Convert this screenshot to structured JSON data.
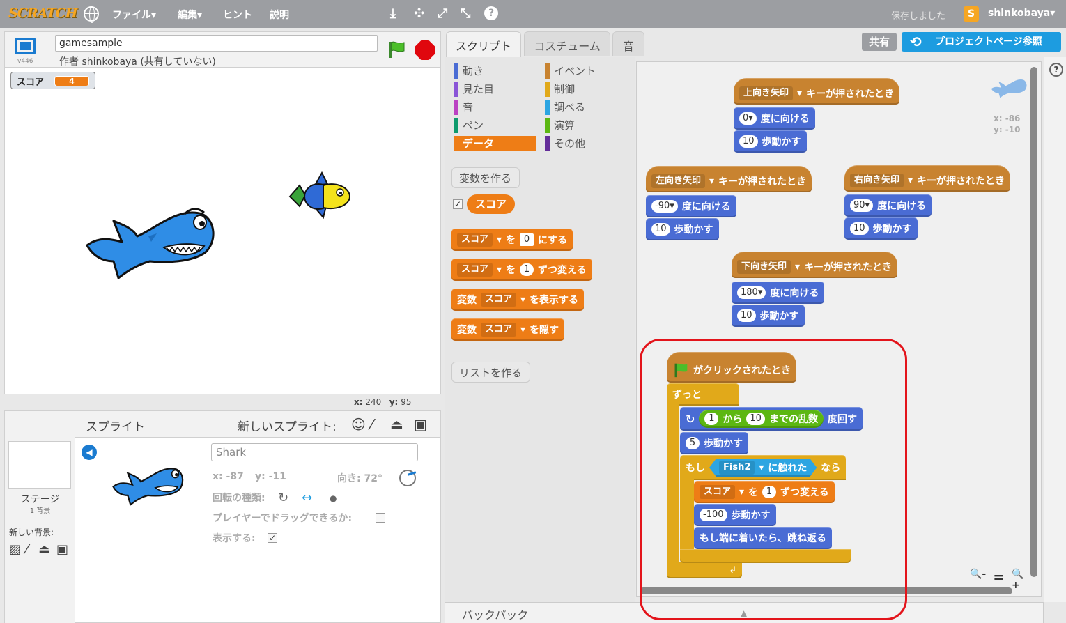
{
  "topbar": {
    "logo": "SCRATCH",
    "menu": [
      "ファイル▾",
      "編集▾",
      "ヒント",
      "説明"
    ],
    "tools": [
      "⤓",
      "✣",
      "⤢",
      "⤡",
      "?"
    ],
    "saved_status": "保存しました",
    "user_initial": "S",
    "user_name": "shinkobaya▾"
  },
  "stage": {
    "version": "v446",
    "project_title": "gamesample",
    "author": "作者 shinkobaya (共有していない)",
    "monitor": {
      "label": "スコア",
      "value": "4"
    },
    "coords": {
      "x_label": "x:",
      "x_value": "240",
      "y_label": "y:",
      "y_value": "95"
    }
  },
  "sprite_pane": {
    "title": "スプライト",
    "new_sprite_label": "新しいスプライト:",
    "stage_label": "ステージ",
    "stage_bg_count": "1 背景",
    "new_bg_label": "新しい背景:",
    "sprite_name": "Shark",
    "x_label": "x: -87",
    "y_label": "y: -11",
    "direction_label": "向き: 72°",
    "rotation_label": "回転の種類:",
    "drag_label": "プレイヤーでドラッグできるか:",
    "show_label": "表示する:",
    "show_checked": "✓"
  },
  "tabs": {
    "scripts": "スクリプト",
    "costumes": "コスチューム",
    "sounds": "音"
  },
  "header_buttons": {
    "share": "共有",
    "project_page": "プロジェクトページ参照"
  },
  "palette": {
    "categories_left": [
      {
        "label": "動き",
        "color": "#4a6cd4"
      },
      {
        "label": "見た目",
        "color": "#8a55d7"
      },
      {
        "label": "音",
        "color": "#bb42c3"
      },
      {
        "label": "ペン",
        "color": "#0e9a6c"
      },
      {
        "label": "データ",
        "color": "#ee7d16"
      }
    ],
    "categories_right": [
      {
        "label": "イベント",
        "color": "#c88330"
      },
      {
        "label": "制御",
        "color": "#e1a91a"
      },
      {
        "label": "調べる",
        "color": "#2ca5e2"
      },
      {
        "label": "演算",
        "color": "#5cb712"
      },
      {
        "label": "その他",
        "color": "#632d99"
      }
    ],
    "make_variable": "変数を作る",
    "variable_checked": "✓",
    "variable_name": "スコア",
    "set_block": {
      "var": "スコア",
      "to": "を",
      "value": "0",
      "suffix": "にする"
    },
    "change_block": {
      "var": "スコア",
      "to": "を",
      "value": "1",
      "suffix": "ずつ変える"
    },
    "show_block": {
      "prefix": "変数",
      "var": "スコア",
      "suffix": "を表示する"
    },
    "hide_block": {
      "prefix": "変数",
      "var": "スコア",
      "suffix": "を隠す"
    },
    "make_list": "リストを作る"
  },
  "scripts": {
    "up": {
      "key": "上向き矢印",
      "hat_suffix": "キーが押されたとき",
      "dir": "0▾",
      "dir_suffix": "度に向ける",
      "steps": "10",
      "steps_suffix": "歩動かす"
    },
    "left": {
      "key": "左向き矢印",
      "hat_suffix": "キーが押されたとき",
      "dir": "-90▾",
      "dir_suffix": "度に向ける",
      "steps": "10",
      "steps_suffix": "歩動かす"
    },
    "right": {
      "key": "右向き矢印",
      "hat_suffix": "キーが押されたとき",
      "dir": "90▾",
      "dir_suffix": "度に向ける",
      "steps": "10",
      "steps_suffix": "歩動かす"
    },
    "down": {
      "key": "下向き矢印",
      "hat_suffix": "キーが押されたとき",
      "dir": "180▾",
      "dir_suffix": "度に向ける",
      "steps": "10",
      "steps_suffix": "歩動かす"
    },
    "flag": {
      "hat": "がクリックされたとき",
      "forever": "ずっと",
      "turn_from": "1",
      "turn_from_label": "から",
      "turn_to": "10",
      "turn_random_label": "までの乱数",
      "turn_suffix": "度回す",
      "move_steps": "5",
      "move_suffix": "歩動かす",
      "if_label": "もし",
      "touching_target": "Fish2",
      "touching_suffix": "に触れた",
      "then_label": "なら",
      "change_var": "スコア",
      "change_to": "を",
      "change_value": "1",
      "change_suffix": "ずつ変える",
      "move_back": "-100",
      "move_back_suffix": "歩動かす",
      "bounce": "もし端に着いたら、跳ね返る"
    }
  },
  "corner_sprite": {
    "x": "x: -86",
    "y": "y: -10"
  },
  "zoom": [
    "🔍-",
    "=",
    "🔍+"
  ],
  "backpack": {
    "label": "バックパック",
    "arrow": "▲"
  }
}
